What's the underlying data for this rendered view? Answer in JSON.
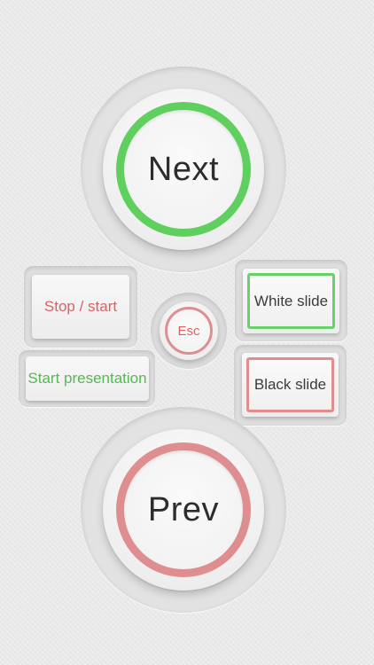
{
  "controls": {
    "next_label": "Next",
    "prev_label": "Prev",
    "stop_start_label": "Stop / start",
    "start_presentation_label": "Start presentation",
    "esc_label": "Esc",
    "white_slide_label": "White slide",
    "black_slide_label": "Black slide"
  },
  "colors": {
    "green_accent": "#5fcf5f",
    "red_accent": "#de8e8e",
    "background": "#e9e9e9"
  }
}
